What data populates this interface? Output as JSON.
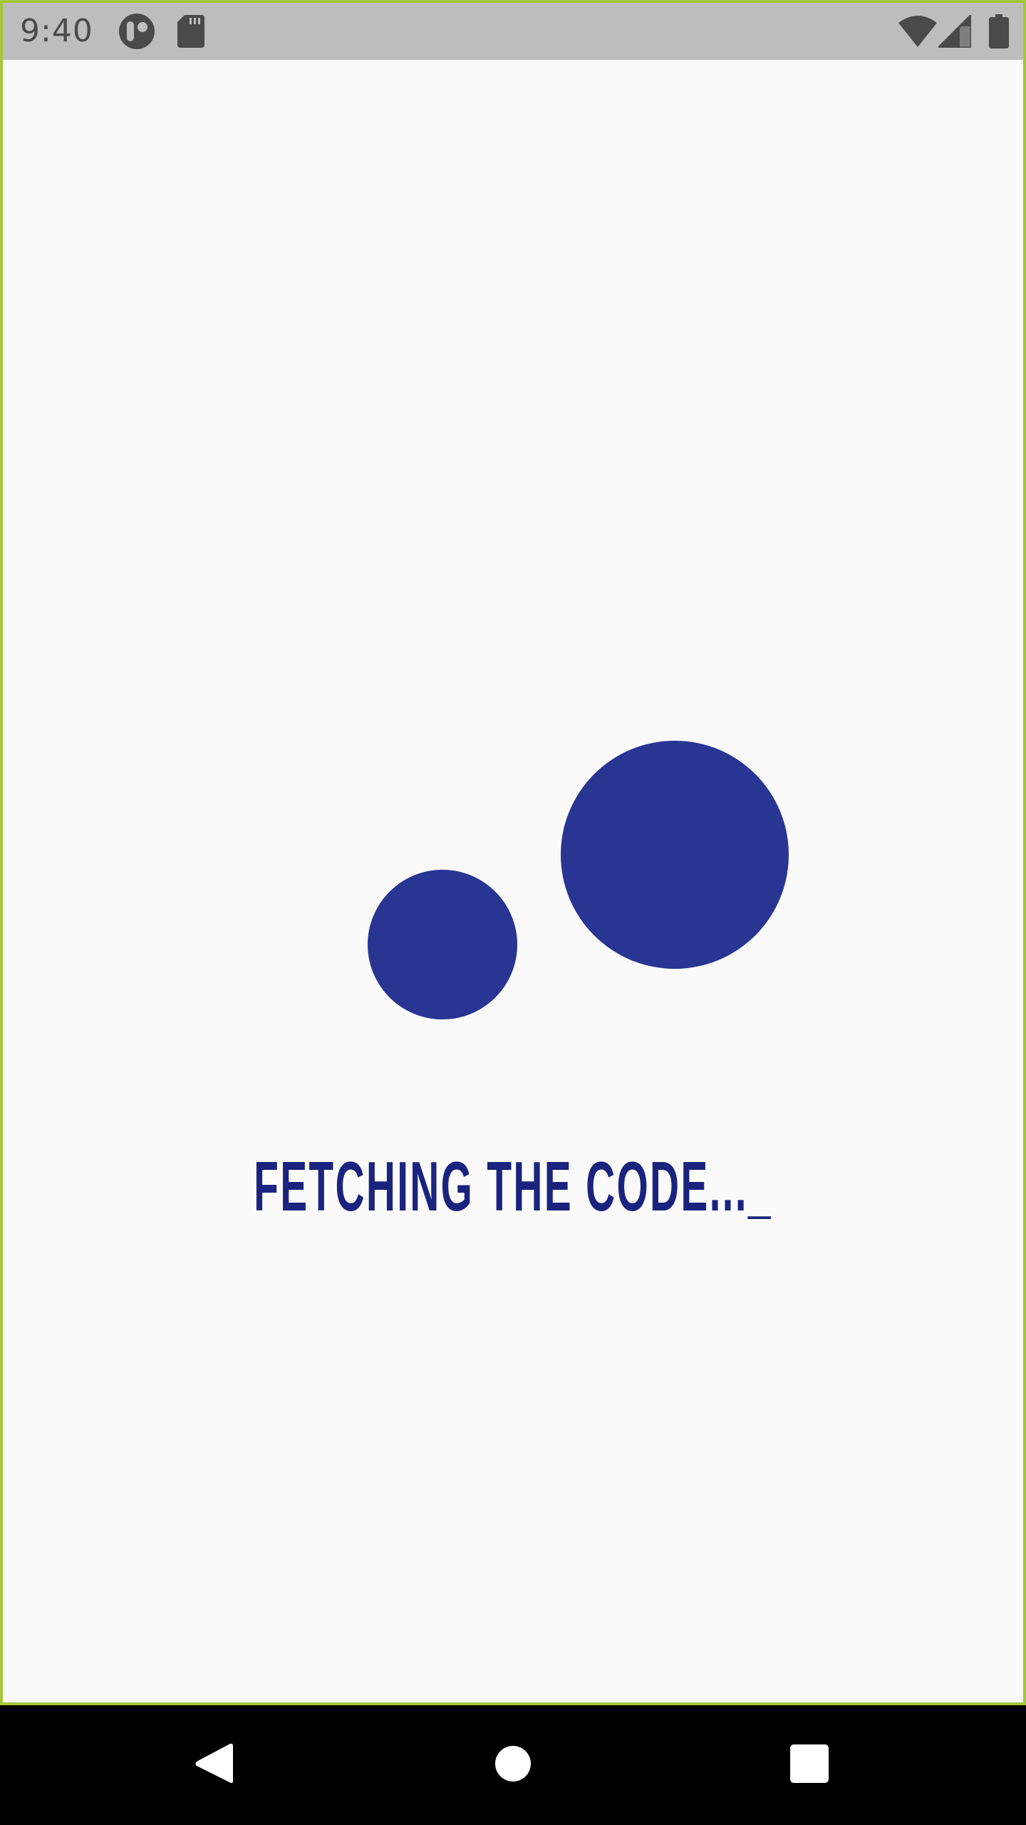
{
  "status_bar": {
    "time": "9:40",
    "icons": [
      "notification-app-icon",
      "sd-card-icon",
      "wifi-icon",
      "cell-signal-icon",
      "battery-icon"
    ]
  },
  "loader": {
    "text": "FETCHING THE CODE..._",
    "dot_color": "#283593",
    "text_color": "#1a237e"
  },
  "nav_bar": {
    "buttons": [
      "back-icon",
      "home-icon",
      "recents-icon"
    ]
  },
  "colors": {
    "status_bar": "#bdbdbd",
    "background": "#fafafa",
    "frame": "#a4c639",
    "nav_bar": "#000000"
  }
}
